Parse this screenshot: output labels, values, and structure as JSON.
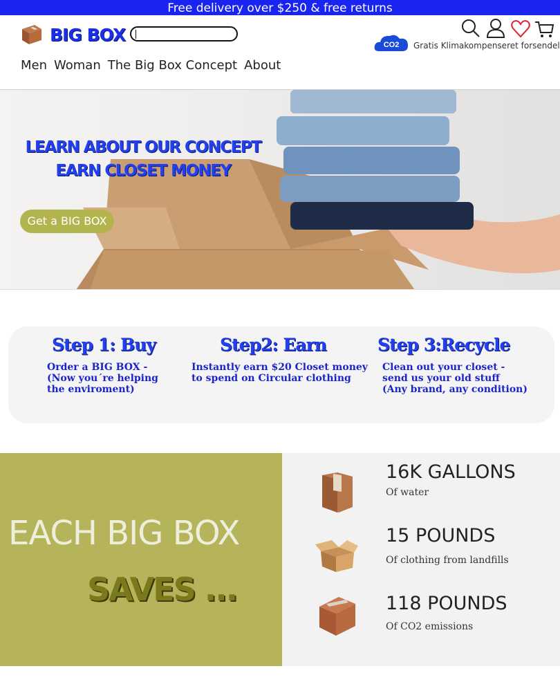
{
  "topbar": {
    "text": "Free delivery over $250 & free returns"
  },
  "header": {
    "logo_text": "BIG BOX",
    "search_placeholder": "",
    "co2_badge": "CO2",
    "co2_text": "Gratis Klimakompenseret forsendelse",
    "icons": [
      "search-icon",
      "user-icon",
      "heart-icon",
      "cart-icon"
    ]
  },
  "nav": {
    "items": [
      "Men",
      "Woman",
      "The Big Box Concept",
      "About"
    ]
  },
  "hero": {
    "title_line1": "LEARN ABOUT OUR CONCEPT",
    "title_line2": "EARN CLOSET MONEY",
    "button": "Get a BIG BOX"
  },
  "steps": [
    {
      "title": "Step 1: Buy",
      "text": "Order a BIG BOX -\n(Now you´re helping\nthe enviroment)"
    },
    {
      "title": "Step2: Earn",
      "text": "Instantly earn $20 Closet money\nto spend on Circular clothing"
    },
    {
      "title": "Step 3:Recycle",
      "text": "Clean out your closet -\n send us your old stuff\n(Any brand, any condition)"
    }
  ],
  "saves": {
    "headline": "EACH BIG BOX",
    "subheadline": "SAVES ...",
    "stats": [
      {
        "big": "16K GALLONS",
        "small": "Of water"
      },
      {
        "big": "15 POUNDS",
        "small": "Of clothing from landfills"
      },
      {
        "big": "118 POUNDS",
        "small": "Of CO2 emissions"
      }
    ]
  },
  "colors": {
    "brand_blue": "#1a24f0",
    "olive": "#b5b45a",
    "button": "#b4b44f"
  }
}
